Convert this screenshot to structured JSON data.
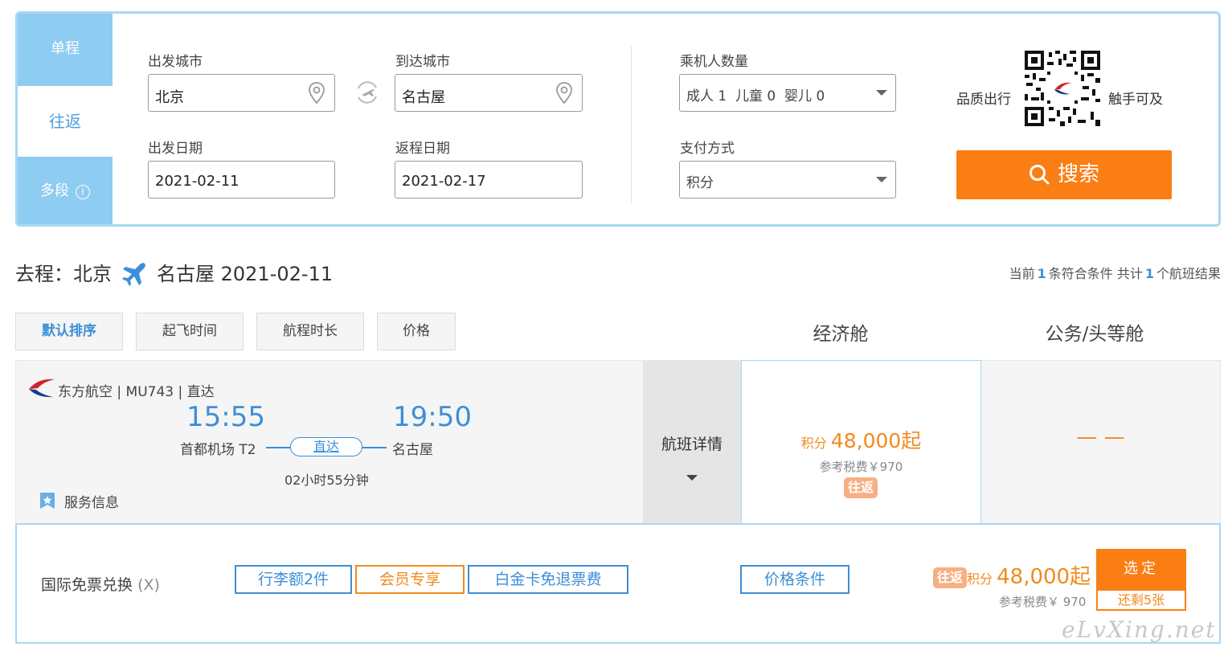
{
  "search": {
    "tabs": [
      {
        "label": "单程"
      },
      {
        "label": "往返"
      },
      {
        "label": "多段",
        "info": "i"
      }
    ],
    "fields": {
      "departure_city": {
        "label": "出发城市",
        "value": "北京"
      },
      "arrival_city": {
        "label": "到达城市",
        "value": "名古屋"
      },
      "departure_date": {
        "label": "出发日期",
        "value": "2021-02-11"
      },
      "return_date": {
        "label": "返程日期",
        "value": "2021-02-17"
      },
      "passengers": {
        "label": "乘机人数量",
        "value": "成人 1  儿童 0  婴儿 0"
      },
      "payment": {
        "label": "支付方式",
        "value": "积分"
      }
    },
    "brand_left": "品质出行",
    "brand_right": "触手可及",
    "search_button": "搜索"
  },
  "route": {
    "prefix": "去程：北京",
    "destination": "名古屋 2021-02-11",
    "summary": {
      "pre": "当前",
      "count": "1",
      "mid": "条符合条件 共计",
      "total": "1",
      "post": "个航班结果"
    }
  },
  "sort": [
    "默认排序",
    "起飞时间",
    "航程时长",
    "价格"
  ],
  "cabins": {
    "economy": "经济舱",
    "business": "公务/头等舱"
  },
  "flight": {
    "airline_line": "东方航空 | MU743 | 直达",
    "dep_time": "15:55",
    "arr_time": "19:50",
    "dep_airport": "首都机场 T2",
    "arr_airport": "名古屋",
    "direct": "直达",
    "duration": "02小时55分钟",
    "service": "服务信息",
    "detail": "航班详情",
    "economy": {
      "points_label": "积分",
      "points_value": "48,000起",
      "tax": "参考税费￥970",
      "badge": "往返"
    },
    "business": "— —"
  },
  "fare": {
    "name": "国际免票兑换",
    "suffix": "(X)",
    "tags": [
      "行李额2件",
      "会员专享",
      "白金卡免退票费",
      "价格条件"
    ],
    "badge": "往返",
    "points_label": "积分",
    "points_value": "48,000起",
    "tax": "参考税费￥ 970",
    "select": "选定",
    "remaining": "还剩5张"
  },
  "watermark": "eLvXing.net",
  "colors": {
    "accent_blue": "#3d8fd8",
    "tab_blue": "#8fccf1",
    "orange": "#fb7e14",
    "border_blue": "#a9d8f3"
  }
}
